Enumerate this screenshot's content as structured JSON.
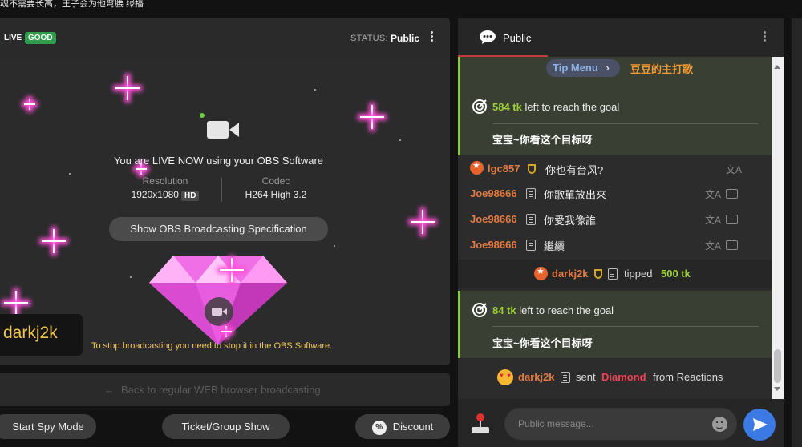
{
  "topbar": {
    "title": "魂不需要长高，王子会为他弯腰 绿播"
  },
  "video": {
    "live_label": "LIVE",
    "live_badge": "GOOD",
    "status_label": "STATUS:",
    "status_value": "Public",
    "live_now_text": "You are LIVE NOW using your OBS Software",
    "resolution_label": "Resolution",
    "resolution_value": "1920x1080",
    "hd_badge": "HD",
    "codec_label": "Codec",
    "codec_value": "H264 High 3.2",
    "spec_button": "Show OBS Broadcasting Specification",
    "stop_note": "To stop broadcasting you need to stop it in the OBS Software.",
    "username": "darkj2k",
    "back_link": "Back to regular WEB browser broadcasting"
  },
  "bottom_buttons": {
    "spy": "Start Spy Mode",
    "ticket": "Ticket/Group Show",
    "discount": "Discount"
  },
  "chat": {
    "tab_label": "Public",
    "tip_menu_label": "Tip Menu",
    "tip_menu_song": "豆豆的主打歌",
    "goal1": {
      "tokens": "584 tk",
      "suffix": "left to reach the goal",
      "text": "宝宝~你看这个目标呀"
    },
    "messages": [
      {
        "name": "lgc857",
        "text": "你也有台风?"
      },
      {
        "name": "Joe98666",
        "text": "你歌單放出來"
      },
      {
        "name": "Joe98666",
        "text": "你愛我像誰"
      },
      {
        "name": "Joe98666",
        "text": "繼續"
      }
    ],
    "tip": {
      "name": "darkj2k",
      "verb": "tipped",
      "amount": "500 tk"
    },
    "goal2": {
      "tokens": "84 tk",
      "suffix": "left to reach the goal",
      "text": "宝宝~你看这个目标呀"
    },
    "reaction": {
      "name": "darkj2k",
      "verb": "sent",
      "item": "Diamond",
      "suffix": "from Reactions"
    },
    "input_placeholder": "Public message..."
  },
  "colors": {
    "accent_green": "#9ed13b",
    "tab_underline": "#c23a3a",
    "send_blue": "#3b7ae5",
    "name_orange": "#e57b42"
  }
}
